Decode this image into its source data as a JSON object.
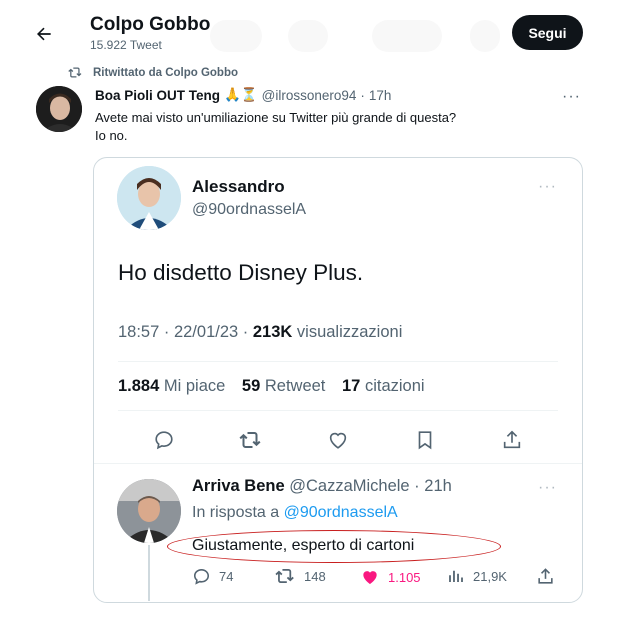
{
  "header": {
    "title": "Colpo Gobbo",
    "tweet_count": "15.922 Tweet",
    "follow_label": "Segui"
  },
  "retweet": {
    "label": "Ritwittato da Colpo Gobbo"
  },
  "main_tweet": {
    "display_name": "Boa Pioli OUT Teng",
    "emoji": "🙏⏳",
    "handle": "@ilrossonero94",
    "separator": "·",
    "time": "17h",
    "text_line1": "Avete mai visto un'umiliazione su Twitter più grande di questa?",
    "text_line2": "Io no.",
    "more": "···"
  },
  "quoted_tweet": {
    "display_name": "Alessandro",
    "handle": "@90ordnasselA",
    "more": "···",
    "text": "Ho disdetto Disney Plus.",
    "timestamp": "18:57 · 22/01/23 · ",
    "views_count": "213K",
    "views_label": " visualizzazioni",
    "stats": {
      "likes_count": "1.884",
      "likes_label": " Mi piace",
      "retweets_count": "59",
      "retweets_label": " Retweet",
      "quotes_count": "17",
      "quotes_label": " citazioni"
    }
  },
  "reply": {
    "display_name": "Arriva Bene",
    "handle_meta": " @CazzaMichele · 21h",
    "in_reply_prefix": "In risposta a ",
    "in_reply_handle": "@90ordnasselA",
    "text": "Giustamente, esperto di cartoni",
    "more": "···",
    "actions": {
      "replies": "74",
      "retweets": "148",
      "likes": "1.105",
      "views": "21,9K"
    }
  },
  "colors": {
    "accent": "#1d9bf0",
    "like": "#f91880",
    "annotation": "#c81e1e"
  }
}
